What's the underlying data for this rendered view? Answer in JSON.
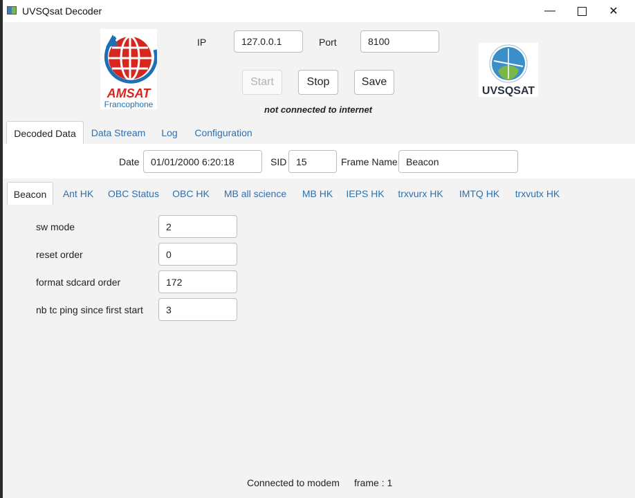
{
  "window": {
    "title": "UVSQsat Decoder",
    "minimize": "—",
    "close": "✕"
  },
  "connection": {
    "ip_label": "IP",
    "ip_value": "127.0.0.1",
    "port_label": "Port",
    "port_value": "8100",
    "start_label": "Start",
    "stop_label": "Stop",
    "save_label": "Save",
    "status": "not connected to internet"
  },
  "logos": {
    "amsat_text": "AMSAT",
    "amsat_sub": "Francophone",
    "uvsqsat_text": "UVSQSAT"
  },
  "main_tabs": [
    "Decoded Data",
    "Data Stream",
    "Log",
    "Configuration"
  ],
  "frame_info": {
    "date_label": "Date",
    "date_value": "01/01/2000 6:20:18",
    "sid_label": "SID",
    "sid_value": "15",
    "frame_name_label": "Frame Name",
    "frame_name_value": "Beacon"
  },
  "sub_tabs": [
    "Beacon",
    "Ant HK",
    "OBC Status",
    "OBC HK",
    "MB all science",
    "MB HK",
    "IEPS HK",
    "trxvurx HK",
    "IMTQ HK",
    "trxvutx HK"
  ],
  "beacon_fields": [
    {
      "label": "sw mode",
      "value": "2"
    },
    {
      "label": "reset order",
      "value": "0"
    },
    {
      "label": "format sdcard order",
      "value": "172"
    },
    {
      "label": "nb tc ping since first start",
      "value": "3"
    }
  ],
  "status_bar": {
    "modem": "Connected to modem",
    "frame": "frame : 1"
  },
  "colors": {
    "tab_link": "#2e6fae",
    "amsat_red": "#d7261e",
    "amsat_blue": "#1f6fb5"
  }
}
